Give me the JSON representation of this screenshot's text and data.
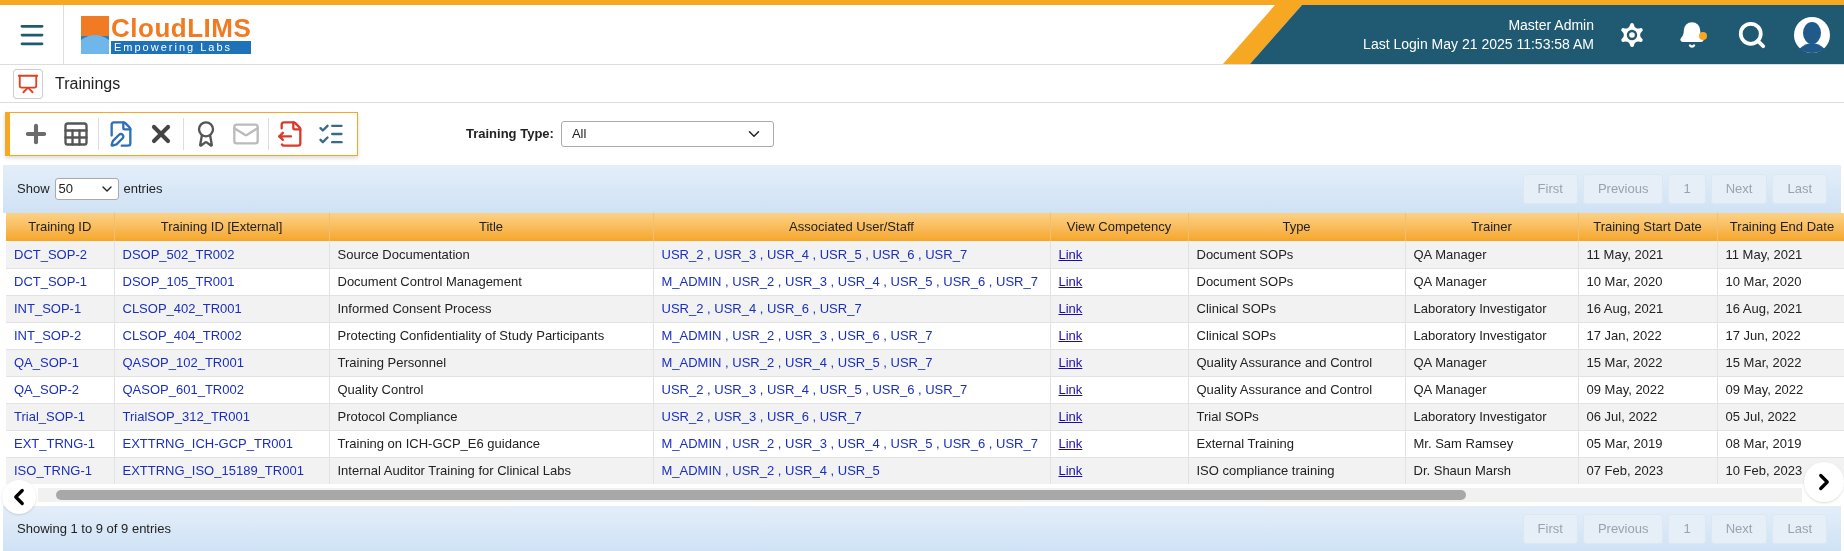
{
  "logo": {
    "name": "CloudLIMS",
    "tagline": "Empowering Labs"
  },
  "user": {
    "name": "Master Admin",
    "last_login": "Last  Login May 21 2025 11:53:58 AM",
    "notification": true
  },
  "page": {
    "title": "Trainings"
  },
  "toolbar": [
    {
      "buttons": [
        {
          "kind": "add",
          "disabled": false
        },
        {
          "kind": "grid",
          "disabled": false
        }
      ]
    },
    {
      "buttons": [
        {
          "kind": "edit",
          "disabled": false
        },
        {
          "kind": "delete",
          "disabled": false
        }
      ]
    },
    {
      "buttons": [
        {
          "kind": "award",
          "disabled": false
        },
        {
          "kind": "mail",
          "disabled": true
        }
      ]
    },
    {
      "buttons": [
        {
          "kind": "export",
          "disabled": false
        },
        {
          "kind": "checklist",
          "disabled": false
        }
      ]
    }
  ],
  "filter": {
    "label": "Training Type:",
    "value": "All"
  },
  "length": {
    "before": "Show",
    "value": "50",
    "after": "entries"
  },
  "pagination_top": [
    {
      "label": "First",
      "disabled": true
    },
    {
      "label": "Previous",
      "disabled": true
    },
    {
      "label": "1",
      "disabled": true
    },
    {
      "label": "Next",
      "disabled": true
    },
    {
      "label": "Last",
      "disabled": true
    }
  ],
  "pagination_bottom": [
    {
      "label": "First",
      "disabled": true
    },
    {
      "label": "Previous",
      "disabled": true
    },
    {
      "label": "1",
      "disabled": true
    },
    {
      "label": "Next",
      "disabled": true
    },
    {
      "label": "Last",
      "disabled": true
    }
  ],
  "table": {
    "columns": [
      "Training ID",
      "Training ID [External]",
      "Title",
      "Associated User/Staff",
      "View Competency",
      "Type",
      "Trainer",
      "Training Start Date",
      "Training End Date"
    ],
    "rows": [
      [
        "DCT_SOP-2",
        "DSOP_502_TR002",
        "Source Documentation",
        "USR_2 , USR_3 , USR_4 , USR_5 , USR_6 , USR_7",
        "Link",
        "Document SOPs",
        "QA Manager",
        "11 May, 2021",
        "11 May, 2021"
      ],
      [
        "DCT_SOP-1",
        "DSOP_105_TR001",
        "Document Control Management",
        "M_ADMIN , USR_2 , USR_3 , USR_4 , USR_5 , USR_6 , USR_7",
        "Link",
        "Document SOPs",
        "QA Manager",
        "10 Mar, 2020",
        "10 Mar, 2020"
      ],
      [
        "INT_SOP-1",
        "CLSOP_402_TR001",
        "Informed Consent Process",
        "USR_2 , USR_4 , USR_6 , USR_7",
        "Link",
        "Clinical SOPs",
        "Laboratory Investigator",
        "16 Aug, 2021",
        "16 Aug, 2021"
      ],
      [
        "INT_SOP-2",
        "CLSOP_404_TR002",
        "Protecting Confidentiality of Study Participants",
        "M_ADMIN , USR_2 , USR_3 , USR_6 , USR_7",
        "Link",
        "Clinical SOPs",
        "Laboratory Investigator",
        "17 Jan, 2022",
        "17 Jun, 2022"
      ],
      [
        "QA_SOP-1",
        "QASOP_102_TR001",
        "Training Personnel",
        "M_ADMIN , USR_2 , USR_4 , USR_5 , USR_7",
        "Link",
        "Quality Assurance and Control",
        "QA Manager",
        "15 Mar, 2022",
        "15 Mar, 2022"
      ],
      [
        "QA_SOP-2",
        "QASOP_601_TR002",
        "Quality Control",
        "USR_2 , USR_3 , USR_4 , USR_5 , USR_6 , USR_7",
        "Link",
        "Quality Assurance and Control",
        "QA Manager",
        "09 May, 2022",
        "09 May, 2022"
      ],
      [
        "Trial_SOP-1",
        "TrialSOP_312_TR001",
        "Protocol Compliance",
        "USR_2 , USR_3 , USR_6 , USR_7",
        "Link",
        "Trial SOPs",
        "Laboratory Investigator",
        "06 Jul, 2022",
        "05 Jul, 2022"
      ],
      [
        "EXT_TRNG-1",
        "EXTTRNG_ICH-GCP_TR001",
        "Training on ICH-GCP_E6 guidance",
        "M_ADMIN , USR_2 , USR_3 , USR_4 , USR_5 , USR_6 , USR_7",
        "Link",
        "External Training",
        "Mr. Sam Ramsey",
        "05 Mar, 2019",
        "08 Mar, 2019"
      ],
      [
        "ISO_TRNG-1",
        "EXTTRNG_ISO_15189_TR001",
        "Internal Auditor Training for Clinical Labs",
        "M_ADMIN , USR_2 , USR_4 , USR_5",
        "Link",
        "ISO compliance training",
        "Dr. Shaun Marsh",
        "07 Feb, 2023",
        "10 Feb, 2023"
      ]
    ]
  },
  "info": "Showing 1 to 9 of 9 entries"
}
